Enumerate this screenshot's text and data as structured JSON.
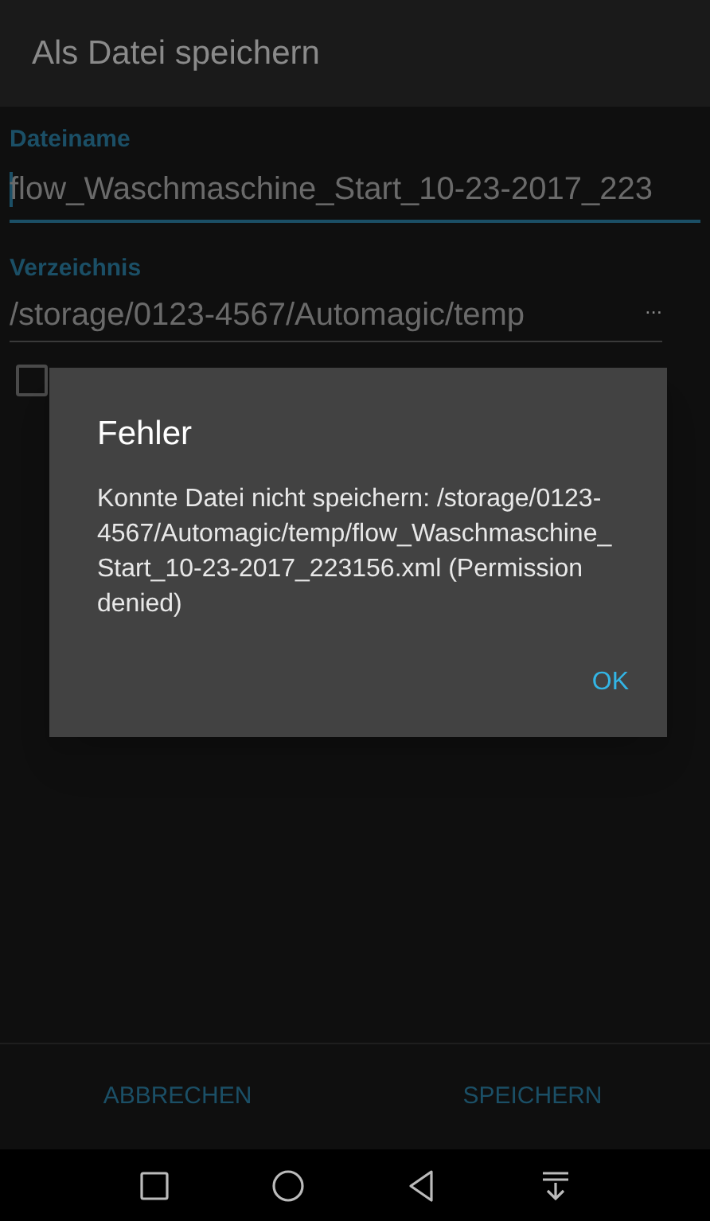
{
  "app_bar": {
    "title": "Als Datei speichern"
  },
  "form": {
    "filename": {
      "label": "Dateiname",
      "value": "flow_Waschmaschine_Start_10-23-2017_223"
    },
    "directory": {
      "label": "Verzeichnis",
      "value": "/storage/0123-4567/Automagic/temp",
      "more": "..."
    },
    "checkbox": {
      "checked": false
    }
  },
  "buttons": [
    {
      "label": "ABBRECHEN"
    },
    {
      "label": "SPEICHERN"
    }
  ],
  "dialog": {
    "title": "Fehler",
    "message": "Konnte Datei nicht speichern: /storage/0123-4567/Automagic/temp/flow_Waschmaschine_Start_10-23-2017_223156.xml (Permission denied)",
    "button": "OK"
  },
  "nav_bar": [
    {
      "kind": "recents"
    },
    {
      "kind": "home"
    },
    {
      "kind": "back"
    },
    {
      "kind": "notifications"
    }
  ]
}
